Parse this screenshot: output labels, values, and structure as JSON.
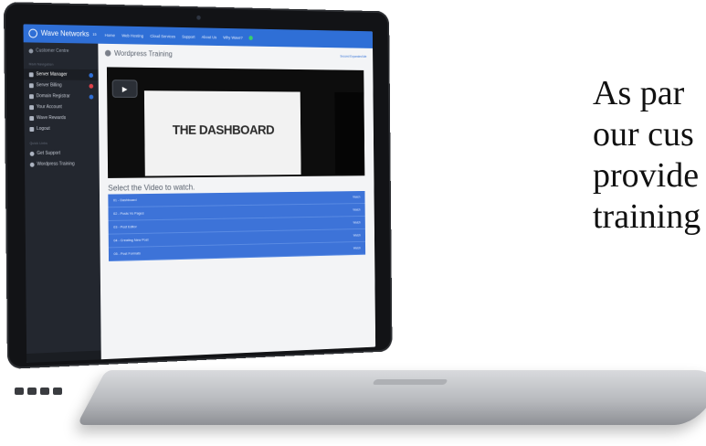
{
  "app": {
    "brand": "Wave Networks",
    "brand_sup": "15",
    "subtitle": "Customer Centre"
  },
  "sidebar": {
    "section1_title": "Main Navigation",
    "items": [
      {
        "label": "Server Manager",
        "icon": "server-icon",
        "badge": "#2f6fd6"
      },
      {
        "label": "Server Billing",
        "icon": "dollar-icon",
        "badge": "#e0424a"
      },
      {
        "label": "Domain Registrar",
        "icon": "globe-icon",
        "badge": "#2f6fd6"
      },
      {
        "label": "Your Account",
        "icon": "user-icon"
      },
      {
        "label": "Wave Rewards",
        "icon": "grid-icon"
      },
      {
        "label": "Logout",
        "icon": "logout-icon"
      }
    ],
    "section2_title": "Quick Links",
    "links": [
      {
        "label": "Get Support",
        "icon": "support-icon"
      },
      {
        "label": "Wordpress Training",
        "icon": "wordpress-icon"
      }
    ]
  },
  "topnav": {
    "items": [
      "Home",
      "Web Hosting",
      "Cloud Services",
      "Support",
      "About Us",
      "Why Wave?"
    ]
  },
  "main": {
    "page_title": "Wordpress Training",
    "user_link": "Second Expanded Me",
    "video_title": "THE DASHBOARD",
    "select_title": "Select the Video to watch.",
    "videos": [
      {
        "label": "01 - Dashboard",
        "action": "Watch"
      },
      {
        "label": "02 - Posts Vs Pages",
        "action": "Watch"
      },
      {
        "label": "03 - Post Editor",
        "action": "Watch"
      },
      {
        "label": "04 - Creating New Post",
        "action": "Watch"
      },
      {
        "label": "05 - Post Formats",
        "action": "Watch"
      }
    ]
  },
  "caption": {
    "lines": [
      "As par",
      "our cus",
      "provide",
      "training"
    ]
  },
  "colors": {
    "accent": "#2f6fd6",
    "sidebar_bg": "#23272f",
    "row_bg": "#3d73d8"
  }
}
